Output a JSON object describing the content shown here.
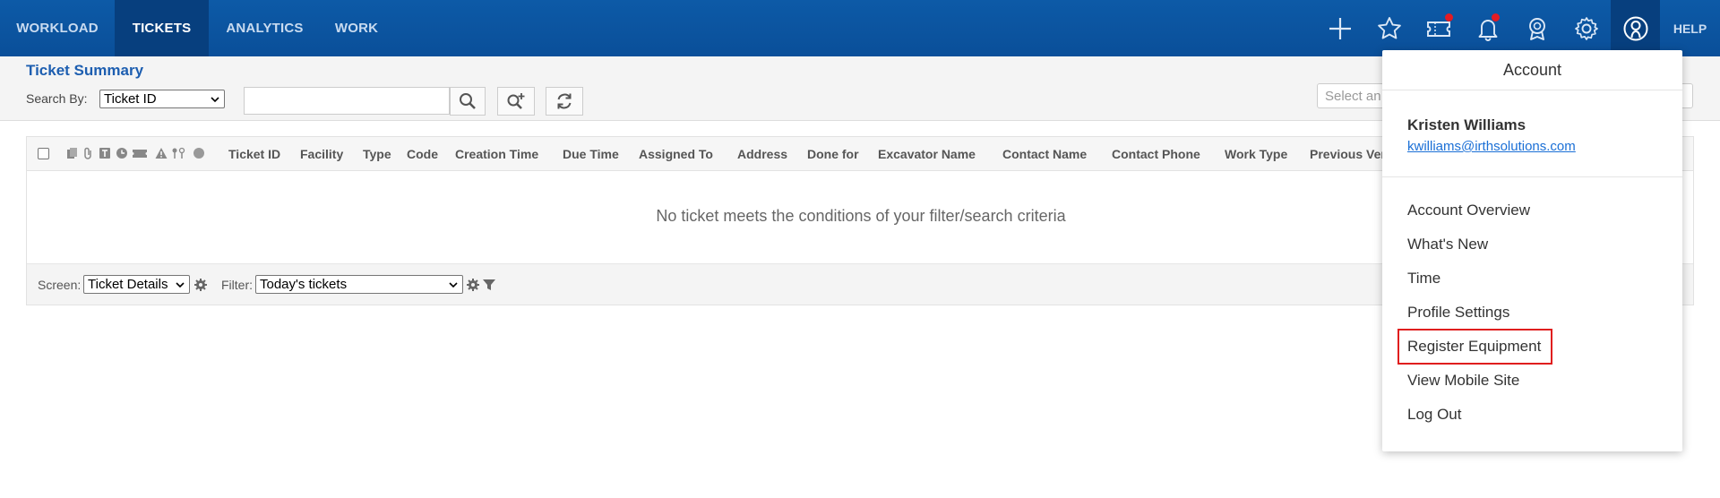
{
  "nav": {
    "tabs": [
      {
        "label": "WORKLOAD"
      },
      {
        "label": "TICKETS"
      },
      {
        "label": "ANALYTICS"
      },
      {
        "label": "WORK"
      }
    ],
    "icons": [
      "plus-icon",
      "star-icon",
      "ticket-icon",
      "bell-icon",
      "award-icon",
      "gear-icon",
      "user-icon"
    ],
    "help_label": "HELP",
    "colors": {
      "bar": "#0a4f99",
      "active": "#073f7e",
      "alert": "#e31b23"
    }
  },
  "toolbar": {
    "title": "Ticket Summary",
    "search_by_label": "Search By:",
    "search_by_value": "Ticket ID",
    "search_value": "",
    "select_placeholder": "Select an"
  },
  "grid": {
    "columns": [
      "Ticket ID",
      "Facility",
      "Type",
      "Code",
      "Creation Time",
      "Due Time",
      "Assigned To",
      "Address",
      "Done for",
      "Excavator Name",
      "Contact Name",
      "Contact Phone",
      "Work Type",
      "Previous Ver"
    ],
    "empty_message": "No ticket meets the conditions of your filter/search criteria",
    "footer": {
      "screen_label": "Screen:",
      "screen_value": "Ticket Details",
      "filter_label": "Filter:",
      "filter_value": "Today's tickets"
    }
  },
  "account": {
    "title": "Account",
    "name": "Kristen Williams",
    "email": "kwilliams@irthsolutions.com",
    "menu": [
      "Account Overview",
      "What's New",
      "Time",
      "Profile Settings",
      "Register Equipment",
      "View Mobile Site",
      "Log Out"
    ],
    "highlighted_item": "Register Equipment",
    "highlight_color": "#e01e1e"
  }
}
